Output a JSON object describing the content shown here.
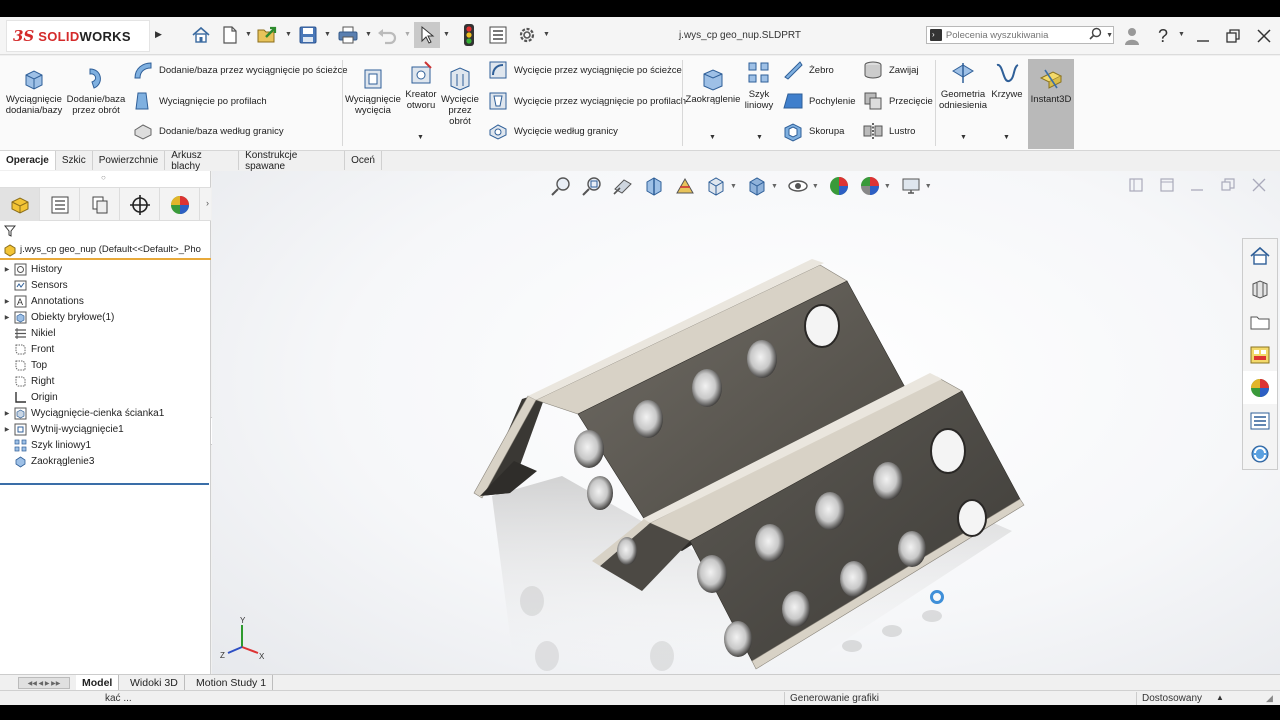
{
  "app": {
    "brand_ds": "3S",
    "brand_solid": "SOLID",
    "brand_works": "WORKS",
    "document_title": "j.wys_cp geo_nup.SLDPRT"
  },
  "search": {
    "placeholder": "Polecenia wyszukiwania"
  },
  "ribbon": {
    "extrude_boss": "Wyciągnięcie dodania/bazy",
    "revolve_boss": "Dodanie/baza przez obrót",
    "sweep_boss": "Dodanie/baza przez wyciągnięcie po ścieżce",
    "loft_boss": "Wyciągnięcie po profilach",
    "boundary_boss": "Dodanie/baza według granicy",
    "extrude_cut": "Wyciągnięcie wycięcia",
    "hole_wizard": "Kreator otworu",
    "revolve_cut": "Wycięcie przez obrót",
    "sweep_cut": "Wycięcie przez wyciągnięcie po ścieżce",
    "loft_cut": "Wycięcie przez wyciągnięcie po profilach",
    "boundary_cut": "Wycięcie według granicy",
    "fillet": "Zaokrąglenie",
    "linear_pattern": "Szyk liniowy",
    "rib": "Żebro",
    "draft": "Pochylenie",
    "shell": "Skorupa",
    "wrap": "Zawijaj",
    "intersect": "Przecięcie",
    "mirror": "Lustro",
    "ref_geometry": "Geometria odniesienia",
    "curves": "Krzywe",
    "instant3d": "Instant3D"
  },
  "tabs": [
    "Operacje",
    "Szkic",
    "Powierzchnie",
    "Arkusz blachy",
    "Konstrukcje spawane",
    "Oceń"
  ],
  "feature_tree": {
    "root": "j.wys_cp geo_nup  (Default<<Default>_Pho",
    "items": [
      {
        "label": "History",
        "icon": "history-icon",
        "expandable": true
      },
      {
        "label": "Sensors",
        "icon": "sensors-icon",
        "expandable": false
      },
      {
        "label": "Annotations",
        "icon": "annotations-icon",
        "expandable": true
      },
      {
        "label": "Obiekty bryłowe(1)",
        "icon": "solid-bodies-icon",
        "expandable": true
      },
      {
        "label": "Nikiel",
        "icon": "material-icon",
        "expandable": false
      },
      {
        "label": "Front",
        "icon": "plane-icon",
        "expandable": false
      },
      {
        "label": "Top",
        "icon": "plane-icon",
        "expandable": false
      },
      {
        "label": "Right",
        "icon": "plane-icon",
        "expandable": false
      },
      {
        "label": "Origin",
        "icon": "origin-icon",
        "expandable": false
      },
      {
        "label": "Wyciągnięcie-cienka ścianka1",
        "icon": "extrude-feature-icon",
        "expandable": true
      },
      {
        "label": "Wytnij-wyciągnięcie1",
        "icon": "cut-feature-icon",
        "expandable": true
      },
      {
        "label": "Szyk liniowy1",
        "icon": "pattern-feature-icon",
        "expandable": false
      },
      {
        "label": "Zaokrąglenie3",
        "icon": "fillet-feature-icon",
        "expandable": false
      }
    ]
  },
  "bottom_tabs": [
    "Model",
    "Widoki 3D",
    "Motion Study 1"
  ],
  "status": {
    "left": "kać ...",
    "middle": "Generowanie grafiki",
    "units": "Dostosowany"
  },
  "triad": {
    "x": "X",
    "y": "Y",
    "z": "Z"
  },
  "colors": {
    "brand_red": "#d42a2a",
    "active_feature_line": "#3a6ea8",
    "root_underline": "#e8a93a",
    "model_face": "#5e5b55",
    "model_edge": "#d8d2c6"
  }
}
